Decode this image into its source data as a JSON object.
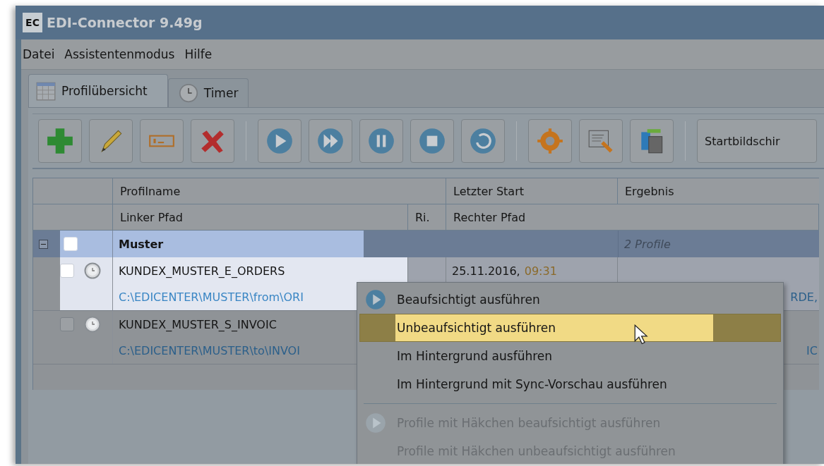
{
  "window": {
    "logo": "EC",
    "title": "EDI-Connector 9.49g"
  },
  "menu_bar": [
    {
      "label": "Datei"
    },
    {
      "label": "Assistentenmodus"
    },
    {
      "label": "Hilfe"
    }
  ],
  "tabs": [
    {
      "label": "Profilübersicht",
      "selected": true
    },
    {
      "label": "Timer",
      "selected": false
    }
  ],
  "toolbar": {
    "start_button": "Startbildschir"
  },
  "table": {
    "header_top": [
      "Profilname",
      "Letzter Start",
      "Ergebnis"
    ],
    "header_bottom": [
      "Linker Pfad",
      "Ri.",
      "Rechter Pfad"
    ],
    "groups": [
      {
        "name": "Muster",
        "expanded": true,
        "checked": false,
        "summary": "2 Profile",
        "rows": [
          {
            "selected": true,
            "checked": false,
            "name": "KUNDEX_MUSTER_E_ORDERS",
            "last_start_date": "25.11.2016,",
            "last_start_time": "09:31",
            "left_path": "C:\\EDICENTER\\MUSTER\\from\\ORI",
            "right_path": "RDE,"
          },
          {
            "selected": false,
            "checked": false,
            "name": "KUNDEX_MUSTER_S_INVOIC",
            "left_path": "C:\\EDICENTER\\MUSTER\\to\\INVOI",
            "right_path": "IC"
          }
        ]
      }
    ]
  },
  "context_menu": [
    {
      "kind": "play",
      "label": "Beaufsichtigt ausführen",
      "selected": false,
      "disabled": false
    },
    {
      "kind": "plain",
      "label": "Unbeaufsichtigt ausführen",
      "selected": true,
      "disabled": false
    },
    {
      "kind": "plain",
      "label": "Im Hintergrund ausführen",
      "selected": false,
      "disabled": false
    },
    {
      "kind": "plain",
      "label": "Im Hintergrund mit Sync-Vorschau ausführen",
      "selected": false,
      "disabled": false
    },
    {
      "kind": "separator"
    },
    {
      "kind": "play",
      "label": "Profile mit Häkchen beaufsichtigt ausführen",
      "selected": false,
      "disabled": true
    },
    {
      "kind": "plain",
      "label": "Profile mit Häkchen unbeaufsichtigt ausführen",
      "selected": false,
      "disabled": true
    }
  ]
}
